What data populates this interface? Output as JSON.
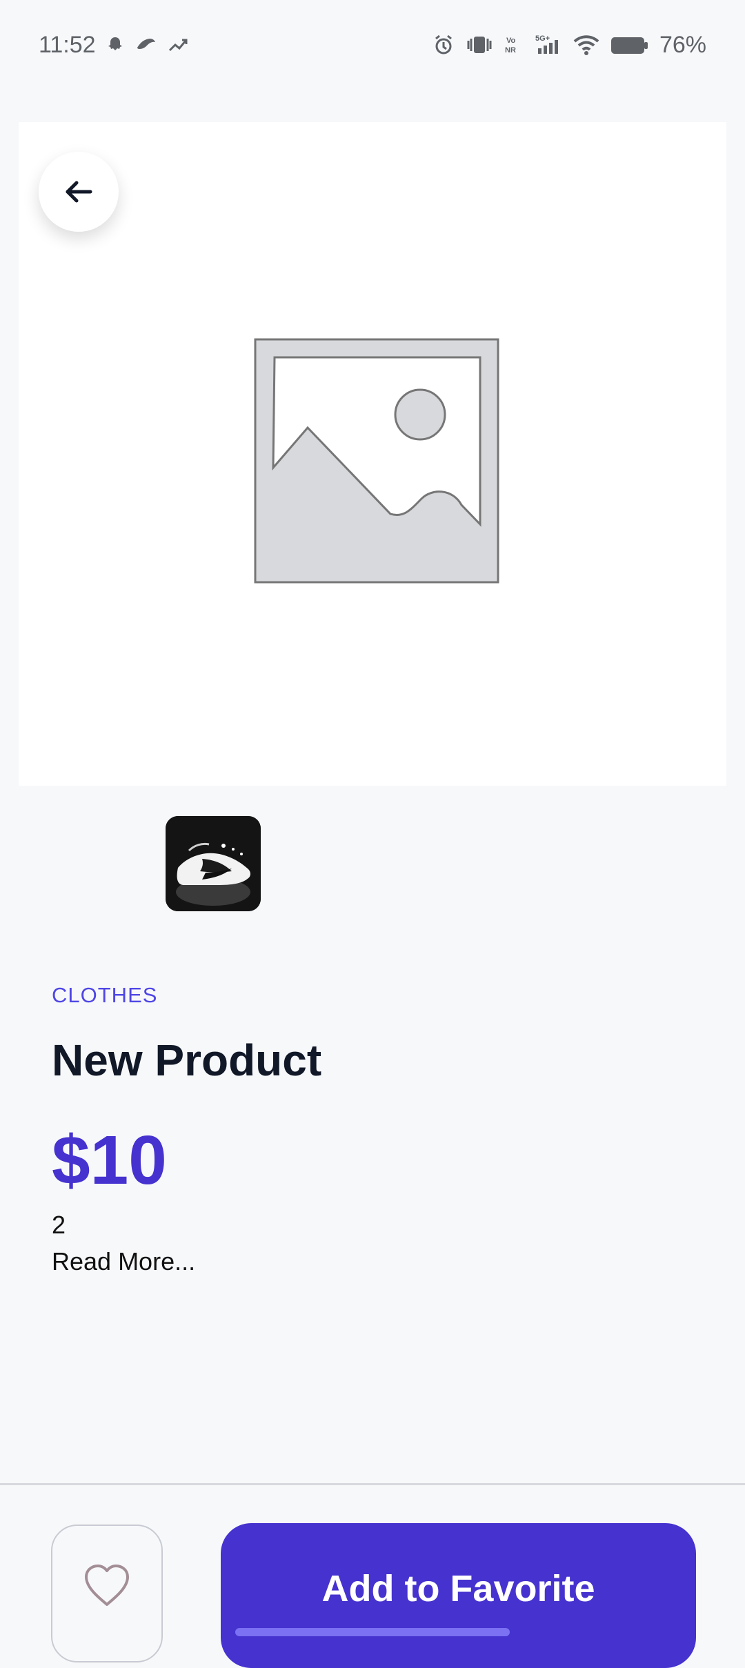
{
  "status_bar": {
    "time": "11:52",
    "battery": "76%",
    "left_icons": [
      "snapchat-icon",
      "app-notification-icon",
      "trend-icon"
    ],
    "right_icons": [
      "alarm-icon",
      "vibrate-icon",
      "volte-icon",
      "signal-icon",
      "wifi-icon",
      "battery-icon"
    ]
  },
  "product": {
    "category": "CLOTHES",
    "name": "New Product",
    "price": "$10",
    "description": "2",
    "read_more": "Read More..."
  },
  "actions": {
    "favorite_icon": "heart-icon",
    "add_label": "Add to Favorite"
  },
  "colors": {
    "accent": "#4532cf",
    "category": "#4f46e5",
    "background": "#f7f8fa"
  }
}
